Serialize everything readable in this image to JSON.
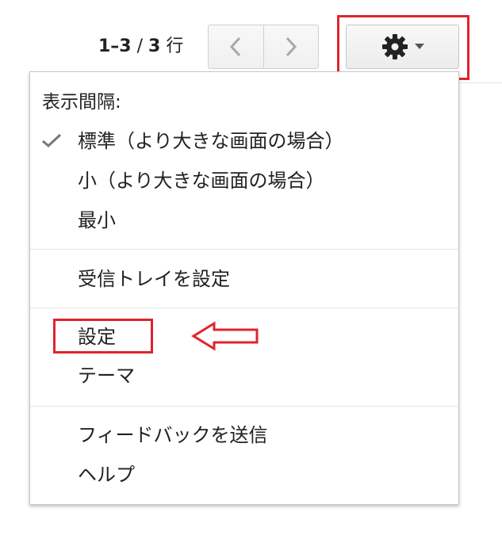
{
  "pager": {
    "range": "1–3",
    "slash": " / ",
    "total": "3",
    "unit": " 行"
  },
  "nav": {
    "prev_icon": "chevron-left-icon",
    "next_icon": "chevron-right-icon"
  },
  "settings_button": {
    "icon": "gear-icon",
    "dropdown_icon": "caret-down-icon"
  },
  "menu": {
    "density_heading": "表示間隔:",
    "density_options": [
      {
        "label": "標準（より大きな画面の場合）",
        "selected": true
      },
      {
        "label": "小（より大きな画面の場合）",
        "selected": false
      },
      {
        "label": "最小",
        "selected": false
      }
    ],
    "configure_inbox": "受信トレイを設定",
    "settings": "設定",
    "themes": "テーマ",
    "send_feedback": "フィードバックを送信",
    "help": "ヘルプ"
  },
  "colors": {
    "annotation_red": "#e0242c",
    "text": "#222222",
    "icon_gray": "#999999"
  }
}
